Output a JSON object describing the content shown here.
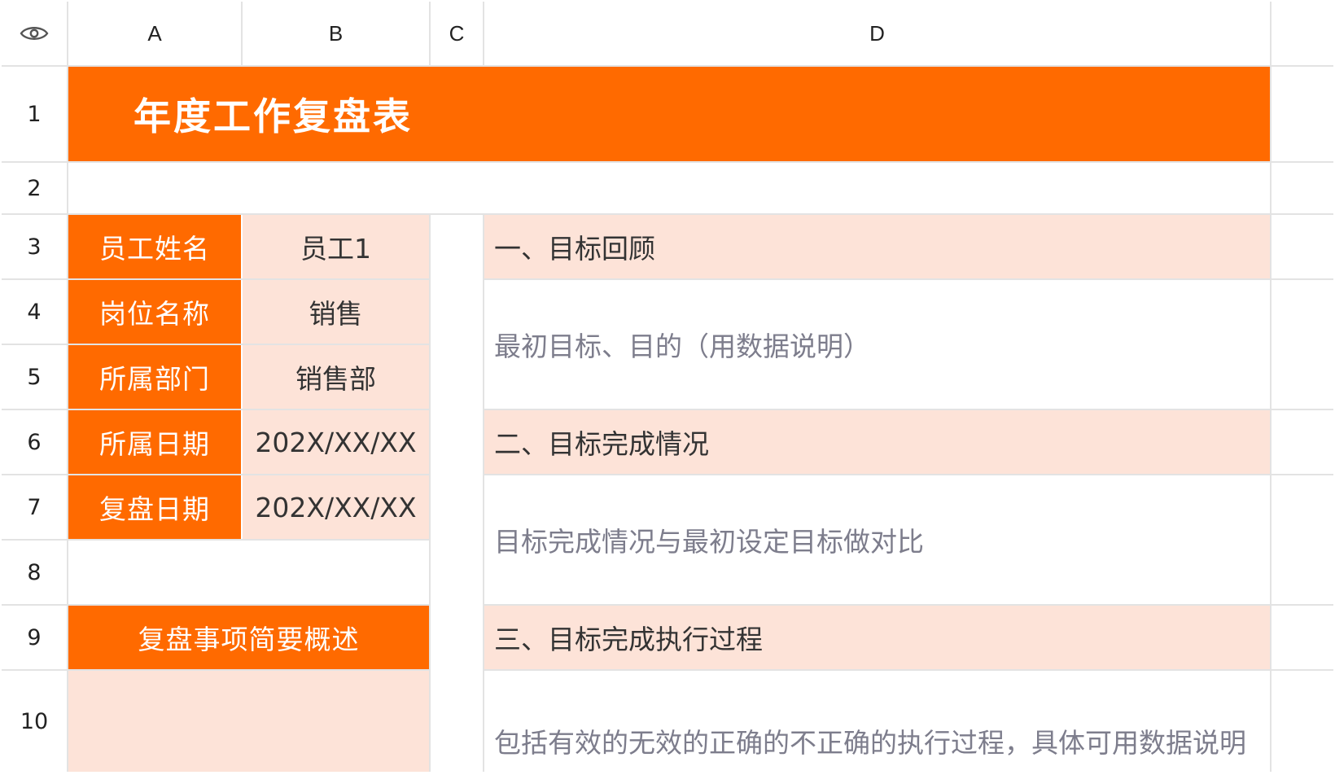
{
  "columns": [
    "A",
    "B",
    "C",
    "D"
  ],
  "rows": [
    "1",
    "2",
    "3",
    "4",
    "5",
    "6",
    "7",
    "8",
    "9",
    "10"
  ],
  "title": "年度工作复盘表",
  "info": [
    {
      "label": "员工姓名",
      "value": "员工1"
    },
    {
      "label": "岗位名称",
      "value": "销售"
    },
    {
      "label": "所属部门",
      "value": "销售部"
    },
    {
      "label": "所属日期",
      "value": "202X/XX/XX"
    },
    {
      "label": "复盘日期",
      "value": "202X/XX/XX"
    }
  ],
  "summary_label": "复盘事项简要概述",
  "sections": [
    {
      "heading": "一、目标回顾",
      "detail": "最初目标、目的（用数据说明）"
    },
    {
      "heading": "二、目标完成情况",
      "detail": "目标完成情况与最初设定目标做对比"
    },
    {
      "heading": "三、目标完成执行过程",
      "detail": "包括有效的无效的正确的不正确的执行过程，具体可用数据说明"
    }
  ],
  "colors": {
    "accent": "#ff6a00",
    "light": "#fde3d8",
    "grid": "#e3e3e3"
  },
  "icons": {
    "corner": "eye-icon"
  }
}
